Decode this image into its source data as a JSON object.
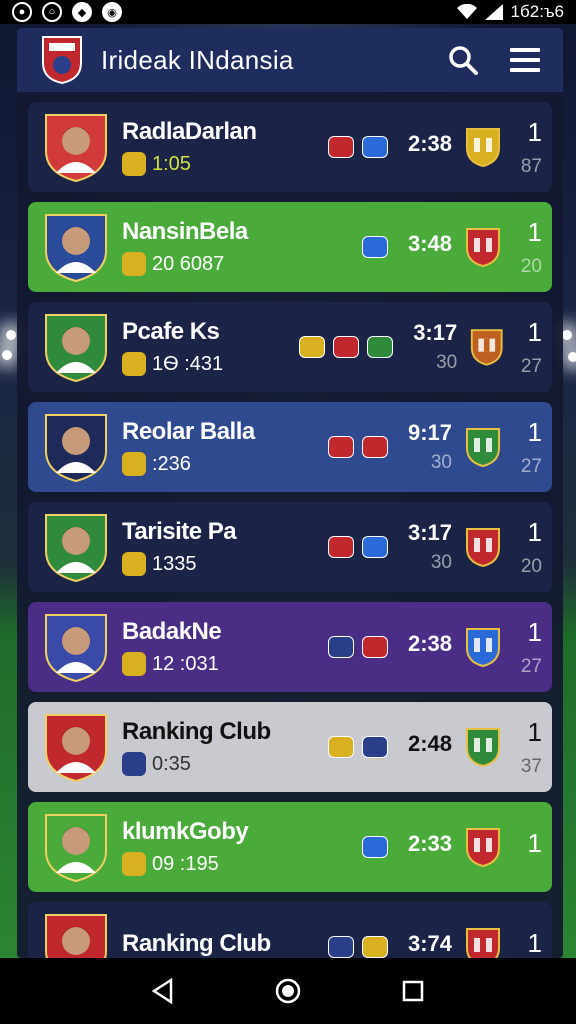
{
  "status_bar": {
    "left_icons": [
      "circle-icon",
      "chat-icon",
      "shield-icon",
      "media-icon"
    ],
    "clock": "1б2:ъ6"
  },
  "header": {
    "title": "Iridеak INdansia",
    "icons": [
      "search-icon",
      "menu-icon"
    ]
  },
  "rows": [
    {
      "name": "RadlaDarlan",
      "sub": "1:05",
      "time": "2:38",
      "time_sub": "",
      "rank": "1",
      "pts": "87",
      "bg": "navy",
      "crest": "#d23a3a",
      "sub_color": "#cfe040"
    },
    {
      "name": "NansinBela",
      "sub": "20 6087",
      "time": "3:48",
      "time_sub": "",
      "rank": "1",
      "pts": "20",
      "bg": "green",
      "crest": "#2a4a9a",
      "sub_color": "#ffffff"
    },
    {
      "name": "Pcafe Ks",
      "sub": "1Ѳ :431",
      "time": "3:17",
      "time_sub": "30",
      "rank": "1",
      "pts": "27",
      "bg": "navy",
      "crest": "#2f8a3c",
      "sub_color": "#ffffff"
    },
    {
      "name": "Reolar Balla",
      "sub": ":236",
      "time": "9:17",
      "time_sub": "30",
      "rank": "1",
      "pts": "27",
      "bg": "blue",
      "crest": "#1e2a5a",
      "sub_color": "#ffffff"
    },
    {
      "name": "Tarisite Pa",
      "sub": "1335",
      "time": "3:17",
      "time_sub": "30",
      "rank": "1",
      "pts": "20",
      "bg": "navy",
      "crest": "#2f8a3c",
      "sub_color": "#ffffff"
    },
    {
      "name": "BadakNe",
      "sub": "12 :031",
      "time": "2:38",
      "time_sub": "",
      "rank": "1",
      "pts": "27",
      "bg": "purple",
      "crest": "#3a4aa8",
      "sub_color": "#ffffff"
    },
    {
      "name": "Ranking Club",
      "sub": "0:35",
      "time": "2:48",
      "time_sub": "",
      "rank": "1",
      "pts": "37",
      "bg": "silver",
      "crest": "#c0282e",
      "sub_color": "#333333"
    },
    {
      "name": "klumkGoby",
      "sub": "09 :195",
      "time": "2:33",
      "time_sub": "",
      "rank": "1",
      "pts": "",
      "bg": "green",
      "crest": "#4aab3a",
      "sub_color": "#ffffff"
    },
    {
      "name": "Ranking Club",
      "sub": "",
      "time": "3:74",
      "time_sub": "",
      "rank": "1",
      "pts": "",
      "bg": "navy",
      "crest": "#c0282e",
      "sub_color": "#ffffff"
    }
  ],
  "colors": {
    "header": "#1f2c5e",
    "navy": "#1b2446",
    "green": "#4aab3a",
    "blue": "#2f4a8e",
    "purple": "#4a2e86",
    "silver": "#c9cad0"
  },
  "nav_bar": [
    "back-icon",
    "home-icon",
    "recents-icon"
  ]
}
